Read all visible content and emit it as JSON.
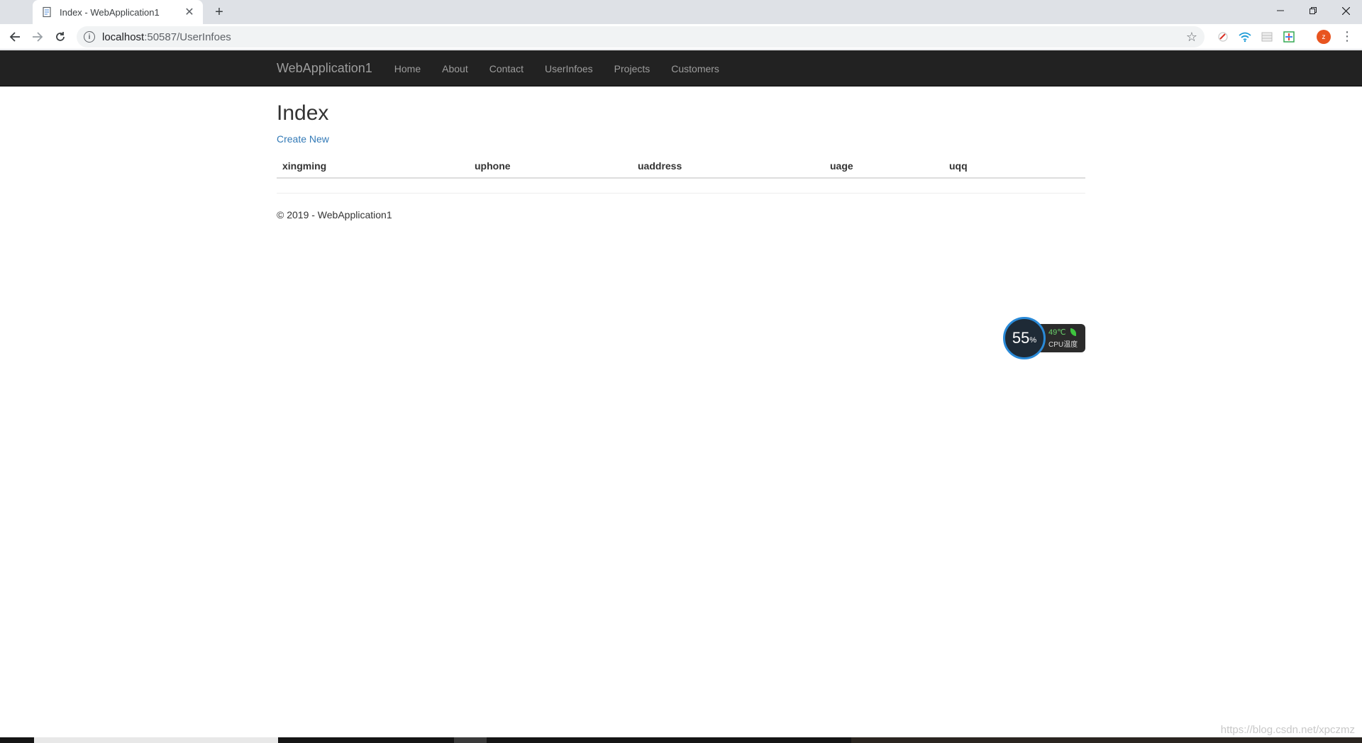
{
  "browser": {
    "tab_title": "Index - WebApplication1",
    "url_host": "localhost",
    "url_rest": ":50587/UserInfoes",
    "profile_initial": "z"
  },
  "navbar": {
    "brand": "WebApplication1",
    "links": [
      "Home",
      "About",
      "Contact",
      "UserInfoes",
      "Projects",
      "Customers"
    ]
  },
  "main": {
    "title": "Index",
    "create_link": "Create New",
    "table": {
      "headers": [
        "xingming",
        "uphone",
        "uaddress",
        "uage",
        "uqq"
      ],
      "rows": []
    }
  },
  "footer": {
    "text": "© 2019 - WebApplication1"
  },
  "cpu_widget": {
    "usage": "55",
    "usage_unit": "%",
    "temperature": "49℃",
    "label": "CPU温度"
  },
  "watermark": "https://blog.csdn.net/xpczmz",
  "colors": {
    "navbar_bg": "#222222",
    "link": "#337ab7",
    "tabstrip_bg": "#dee1e6"
  }
}
